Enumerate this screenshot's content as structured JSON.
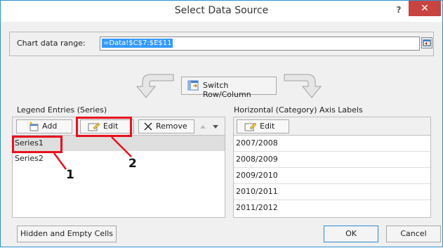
{
  "title": "Select Data Source",
  "help_label": "?",
  "close_label": "✕",
  "range": {
    "label": "Chart data range:",
    "value": "=Data!$C$7:$E$11"
  },
  "switch_button": "Switch Row/Column",
  "legend": {
    "label": "Legend Entries (Series)",
    "add": "Add",
    "edit": "Edit",
    "remove": "Remove",
    "items": [
      "Series1",
      "Series2"
    ]
  },
  "axis": {
    "label": "Horizontal (Category) Axis Labels",
    "edit": "Edit",
    "items": [
      "2007/2008",
      "2008/2009",
      "2009/2010",
      "2010/2011",
      "2011/2012"
    ]
  },
  "footer": {
    "hidden_cells": "Hidden and Empty Cells",
    "ok": "OK",
    "cancel": "Cancel"
  },
  "annotations": [
    "1",
    "2"
  ],
  "colors": {
    "accent_red": "#e8101e",
    "close_red": "#c74440",
    "selection_blue": "#3399ff"
  }
}
